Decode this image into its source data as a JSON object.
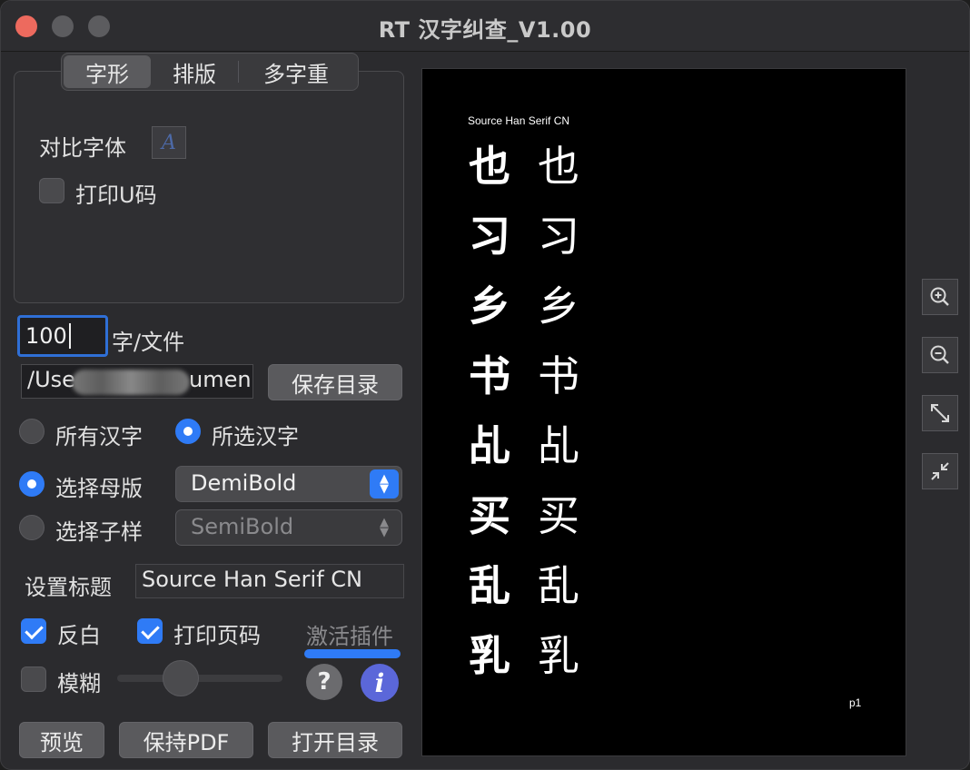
{
  "window": {
    "title": "RT 汉字纠查_V1.00"
  },
  "tabs": [
    {
      "label": "字形",
      "active": true
    },
    {
      "label": "排版",
      "active": false
    },
    {
      "label": "多字重",
      "active": false
    }
  ],
  "glyph_tab": {
    "compare_font_label": "对比字体",
    "compare_font_swatch": "A",
    "print_ucode_label": "打印U码",
    "print_ucode_checked": false
  },
  "per_file": {
    "value": "100",
    "unit_label": "字/文件"
  },
  "output": {
    "path_prefix": "/Use",
    "path_suffix": "umen",
    "save_dir_label": "保存目录"
  },
  "range": {
    "all_label": "所有汉字",
    "selected_label": "所选汉字",
    "selected": "selected"
  },
  "master": {
    "choose_master_label": "选择母版",
    "choose_instance_label": "选择子样",
    "selected": "master",
    "master_value": "DemiBold",
    "instance_value": "SemiBold"
  },
  "title_setting": {
    "label": "设置标题",
    "value": "Source Han Serif CN"
  },
  "options": {
    "invert_label": "反白",
    "invert_checked": true,
    "page_num_label": "打印页码",
    "page_num_checked": true,
    "activate_label": "激活插件",
    "blur_label": "模糊",
    "blur_checked": false
  },
  "help": {
    "help_glyph": "?",
    "info_glyph": "i"
  },
  "bottom_buttons": {
    "preview_label": "预览",
    "save_pdf_label": "保持PDF",
    "open_dir_label": "打开目录"
  },
  "preview": {
    "title": "Source Han Serif CN",
    "page": "p1",
    "rows": [
      [
        "也",
        "也"
      ],
      [
        "习",
        "习"
      ],
      [
        "乡",
        "乡"
      ],
      [
        "书",
        "书"
      ],
      [
        "乩",
        "乩"
      ],
      [
        "买",
        "买"
      ],
      [
        "乱",
        "乱"
      ],
      [
        "乳",
        "乳"
      ]
    ]
  },
  "zoom": [
    {
      "name": "zoom-in-icon"
    },
    {
      "name": "zoom-out-icon"
    },
    {
      "name": "expand-icon"
    },
    {
      "name": "collapse-icon"
    }
  ],
  "colors": {
    "accent": "#2f7bf6",
    "close": "#ed6a5e",
    "info": "#5b67d9"
  }
}
